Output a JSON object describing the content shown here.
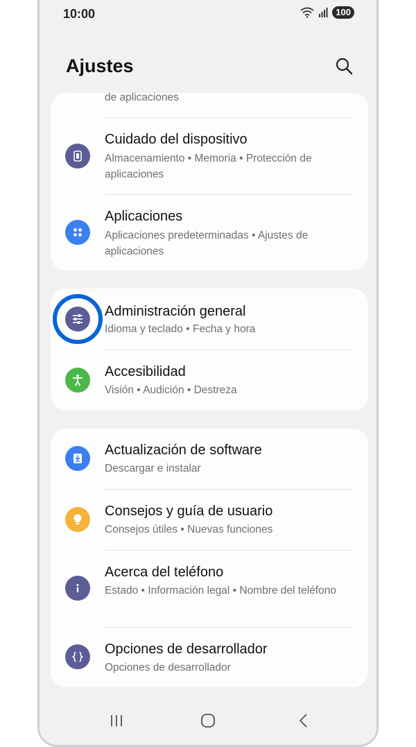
{
  "status": {
    "time": "10:00",
    "battery": "100"
  },
  "header": {
    "title": "Ajustes"
  },
  "card1": {
    "partial_text": "de aplicaciones",
    "items": [
      {
        "title": "Cuidado del dispositivo",
        "subtitle": "Almacenamiento  •  Memoria  •  Protección de aplicaciones",
        "icon": "device-care-icon",
        "color": "#5c5c96"
      },
      {
        "title": "Aplicaciones",
        "subtitle": "Aplicaciones predeterminadas  •  Ajustes de aplicaciones",
        "icon": "apps-icon",
        "color": "#3b7ff0"
      }
    ]
  },
  "card2": {
    "items": [
      {
        "title": "Administración general",
        "subtitle": "Idioma y teclado  •  Fecha y hora",
        "icon": "sliders-icon",
        "color": "#5c5c96"
      },
      {
        "title": "Accesibilidad",
        "subtitle": "Visión  •  Audición  •  Destreza",
        "icon": "accessibility-icon",
        "color": "#4cb84a"
      }
    ]
  },
  "card3": {
    "items": [
      {
        "title": "Actualización de software",
        "subtitle": "Descargar e instalar",
        "icon": "software-update-icon",
        "color": "#3b7ff0"
      },
      {
        "title": "Consejos y guía de usuario",
        "subtitle": "Consejos útiles  •  Nuevas funciones",
        "icon": "lightbulb-icon",
        "color": "#f4b43a"
      },
      {
        "title": "Acerca del teléfono",
        "subtitle": "Estado  •  Información legal  •  Nombre del teléfono",
        "icon": "info-icon",
        "color": "#5c5c96"
      },
      {
        "title": "Opciones de desarrollador",
        "subtitle": "Opciones de desarrollador",
        "icon": "developer-options-icon",
        "color": "#5c5c96"
      }
    ]
  },
  "colors": {
    "highlight_ring": "#0a64d6",
    "background": "#f1f1f3",
    "card": "#fdfdfe"
  }
}
